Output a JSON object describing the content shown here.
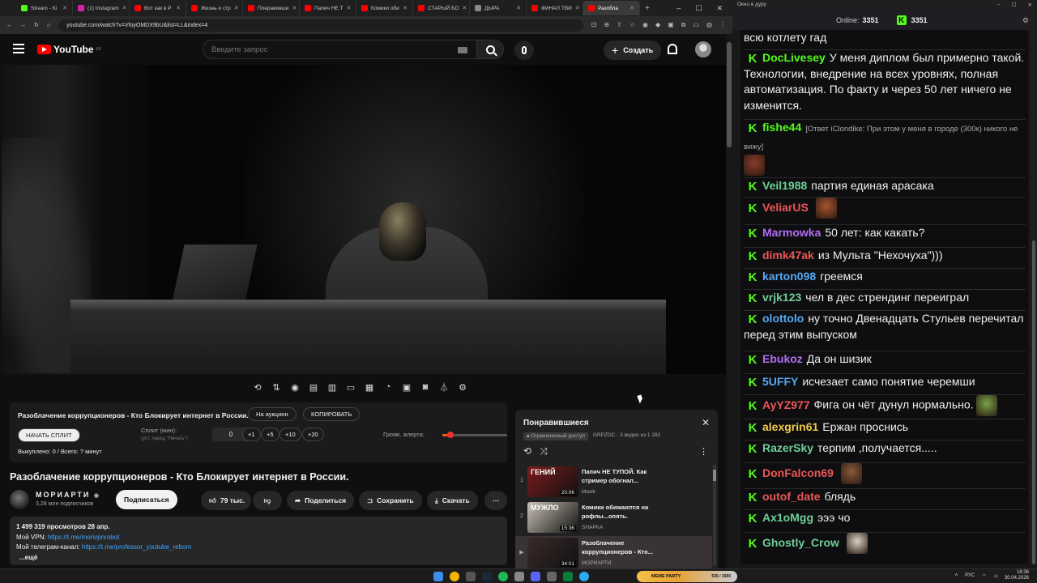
{
  "browser": {
    "tabs": [
      {
        "label": "Stream - Ki",
        "color": "#53fc18"
      },
      {
        "label": "(1) Instagram",
        "color": "#d6249f"
      },
      {
        "label": "Вот как в Р",
        "color": "#ff0000"
      },
      {
        "label": "Жизнь и стр",
        "color": "#ff0000"
      },
      {
        "label": "Понравивши",
        "color": "#ff0000"
      },
      {
        "label": "Папич НЕ Т",
        "color": "#ff0000"
      },
      {
        "label": "Комики оби",
        "color": "#ff0000"
      },
      {
        "label": "СТАРЫЙ БО",
        "color": "#ff0000"
      },
      {
        "label": "ДЫРА",
        "color": "#888888"
      },
      {
        "label": "ФИНАЛ ТВИ",
        "color": "#ff0000"
      },
      {
        "label": "Разобла",
        "color": "#ff0000"
      }
    ],
    "url": "youtube.com/watch?v=VfoyOMDX9bU&list=LL&index=4"
  },
  "youtube": {
    "logo": "YouTube",
    "region": "LV",
    "search_placeholder": "Введите запрос",
    "create_label": "Создать"
  },
  "tools_panel": {
    "title": "Разоблачение коррупционеров - Кто Блокирует интернет в России.",
    "auction_label": "На аукцион",
    "copy_label": "КОПИРОВАТЬ",
    "start_split_label": "НАЧАТЬ СПЛИТ",
    "split_label": "Сплит (мин):",
    "split_hint": "(уст. перед \"Начать\")",
    "split_value": "0",
    "inc_buttons": [
      "+1",
      "+5",
      "+10",
      "+20"
    ],
    "volume_label": "Громк. алерта:",
    "volume_level": 0.12,
    "bought_label": "Выкуплено: 0 / Всего: ? минут"
  },
  "video": {
    "title": "Разоблачение коррупционеров - Кто Блокирует интернет в России.",
    "channel": "МОРИАРТИ",
    "subscribers": "3,28 млн подписчиков",
    "subscribe_label": "Подписаться",
    "likes": "79 тыс.",
    "share_label": "Поделиться",
    "save_label": "Сохранить",
    "download_label": "Скачать",
    "views_date": "1 499 319 просмотров  28 апр.",
    "vpn_label": "Мой VPN:",
    "vpn_link": "https://t.me/morivpnrobot",
    "tg_label": "Мой телеграм-канал:",
    "tg_link": "https://t.me/professor_youtube_reborn",
    "more_label": "...ещё"
  },
  "playlist": {
    "title": "Понравившиеся",
    "access": "Ограниченный доступ",
    "meta": "GRPZDC - 3 видео из 1 282",
    "items": [
      {
        "index": "1",
        "title": "Папич НЕ ТУПОЙ. Как стример обогнал...",
        "channel": "Masik",
        "duration": "20:06",
        "caption": "ГЕНИЙ",
        "color": "#7a1b1b"
      },
      {
        "index": "2",
        "title": "Комики обижаются на рофлы...опять.",
        "channel": "SHAPKA",
        "duration": "15:36",
        "caption": "МУЖЛО",
        "color": "#c9c2b6"
      },
      {
        "index": "▶",
        "title": "Разоблачение коррупционеров - Кто...",
        "channel": "МОРИАРТИ",
        "duration": "34:01",
        "caption": "",
        "color": "#3b2a2a"
      }
    ]
  },
  "chat": {
    "window_title": "Окно в дуру",
    "online_label": "Online:",
    "online_count": "3351",
    "kick_count": "3351",
    "messages": [
      {
        "user": "",
        "color": "#efeff1",
        "text": "всю котлету гад"
      },
      {
        "user": "DocLivesey",
        "color": "#53fc18",
        "text": "У меня диплом был примерно такой. Технологии, внедрение на всех уровнях, полная автоматизация. По факту и через 50 лет ничего не изменится."
      },
      {
        "user": "fishe44",
        "color": "#53fc18",
        "text": "[Ответ iClondike: При этом у меня в городе (300к) никого не вижу]"
      },
      {
        "user": "Veil1988",
        "color": "#6fcf97",
        "text": "партия единая арасака"
      },
      {
        "user": "VeliarUS",
        "color": "#eb5757",
        "text": ""
      },
      {
        "user": "Marmowka",
        "color": "#b26cf2",
        "text": "50 лет: как какать?"
      },
      {
        "user": "dimk47ak",
        "color": "#eb5757",
        "text": "из Мульта \"Нехочуха\")))"
      },
      {
        "user": "karton098",
        "color": "#56a9f2",
        "text": "греемся"
      },
      {
        "user": "vrjk123",
        "color": "#6fcf97",
        "text": "чел в дес стрендинг переиграл"
      },
      {
        "user": "olottolo",
        "color": "#56a9f2",
        "text": "ну точно Двенадцать Стульев перечитал перед этим выпуском"
      },
      {
        "user": "Ebukoz",
        "color": "#b26cf2",
        "text": "Да он шизик"
      },
      {
        "user": "5UFFY",
        "color": "#56a9f2",
        "text": "исчезает само понятие черемши"
      },
      {
        "user": "AyYZ977",
        "color": "#eb5757",
        "text": "Фига он чёт дунул нормально."
      },
      {
        "user": "alexgrin61",
        "color": "#f2c94c",
        "text": "Ержан проснись"
      },
      {
        "user": "RazerSky",
        "color": "#6fcf97",
        "text": "терпим ,получается....."
      },
      {
        "user": "DonFalcon69",
        "color": "#eb5757",
        "text": ""
      },
      {
        "user": "outof_date",
        "color": "#eb5757",
        "text": "блядь"
      },
      {
        "user": "Ax1oMgg",
        "color": "#6fcf97",
        "text": "эээ чо"
      },
      {
        "user": "Ghostly_Crow",
        "color": "#6fcf97",
        "text": ""
      }
    ]
  },
  "taskbar": {
    "widget_label": "MEME PARTY",
    "widget_value": "535 / 1590",
    "lang": "РУС",
    "time": "18:36",
    "date": "30.04.2026"
  }
}
